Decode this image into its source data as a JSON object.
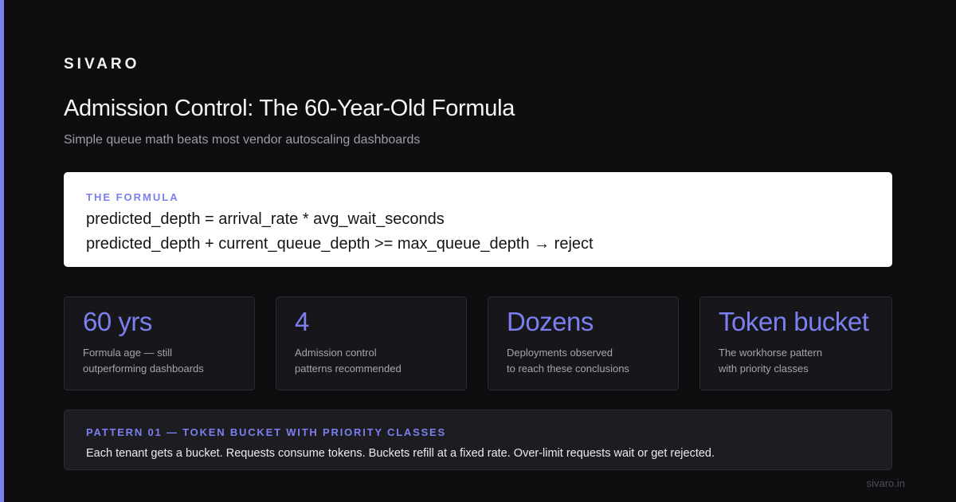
{
  "brand": "SIVARO",
  "title": "Admission Control: The 60-Year-Old Formula",
  "subtitle": "Simple queue math beats most vendor autoscaling dashboards",
  "formula": {
    "label": "THE FORMULA",
    "line1": "predicted_depth = arrival_rate * avg_wait_seconds",
    "line2": "predicted_depth + current_queue_depth >= max_queue_depth → reject"
  },
  "stats": [
    {
      "value": "60 yrs",
      "desc_line1": "Formula age — still",
      "desc_line2": "outperforming dashboards"
    },
    {
      "value": "4",
      "desc_line1": "Admission control",
      "desc_line2": "patterns recommended"
    },
    {
      "value": "Dozens",
      "desc_line1": "Deployments observed",
      "desc_line2": "to reach these conclusions"
    },
    {
      "value": "Token bucket",
      "desc_line1": "The workhorse pattern",
      "desc_line2": "with priority classes"
    }
  ],
  "pattern": {
    "label": "PATTERN 01 — TOKEN BUCKET WITH PRIORITY CLASSES",
    "text": "Each tenant gets a bucket. Requests consume tokens. Buckets refill at a fixed rate. Over-limit requests wait or get rejected."
  },
  "footer": "sivaro.in",
  "colors": {
    "accent": "#7b7ff0",
    "background": "#0e0e11",
    "card": "#17171b"
  }
}
